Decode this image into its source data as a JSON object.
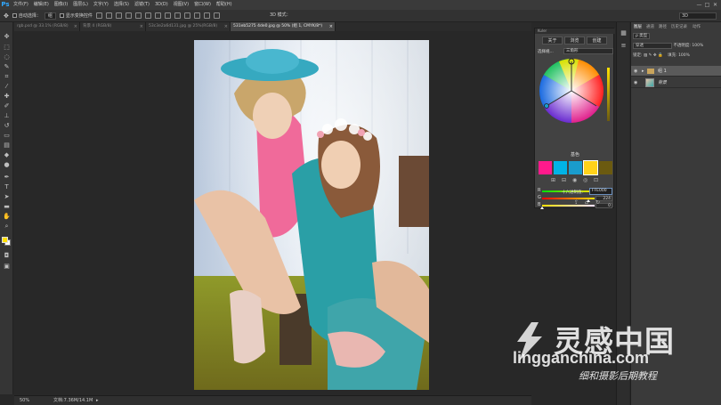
{
  "app": {
    "logo": "Ps",
    "menu": [
      "文件(F)",
      "编辑(E)",
      "图像(I)",
      "图层(L)",
      "文字(Y)",
      "选择(S)",
      "滤镜(T)",
      "3D(D)",
      "视图(V)",
      "窗口(W)",
      "帮助(H)"
    ],
    "window_controls": [
      "—",
      "□",
      "✕"
    ]
  },
  "options_bar": {
    "auto_select_label": "自动选择：",
    "auto_select_value": "组",
    "show_transform_label": "显示变换控件",
    "mode3d_label": "3D 模式：",
    "workspace": "3D"
  },
  "tabs": [
    {
      "label": "rgb.psd @ 33.1% (RGB/8)",
      "active": false
    },
    {
      "label": "背景 4 (RGB/8)",
      "active": false
    },
    {
      "label": "53c3e2a6d131.jpg @ 25%(RGB/8)",
      "active": false
    },
    {
      "label": "531eb5275 4de0.jpg @ 50% (组 1, CMYK/8*)",
      "active": true
    }
  ],
  "status": {
    "zoom": "50%",
    "doc_size": "文档:7.36M/14.1M"
  },
  "color_panel": {
    "title": "Kuler",
    "tabs": [
      "关于",
      "浏览",
      "创建"
    ],
    "scheme_label": "选择规...",
    "scheme_value": "三角形",
    "base_color_label": "基色",
    "swatches": [
      "#ff1a8c",
      "#00b3e6",
      "#1a9ccc",
      "#ffd21a",
      "#6b5a10"
    ],
    "sliders": [
      {
        "label": "R",
        "value": "255",
        "fraction": 1.0,
        "gradient": [
          "#00e000",
          "#ffe000"
        ]
      },
      {
        "label": "G",
        "value": "224",
        "fraction": 0.88,
        "gradient": [
          "#ff0000",
          "#ffe000"
        ]
      },
      {
        "label": "B",
        "value": "0",
        "fraction": 0.0,
        "gradient": [
          "#ffe000",
          "#ffe0ff"
        ]
      }
    ],
    "hex_label": "十六进制值:",
    "hex_value": "FFE000"
  },
  "layers_panel": {
    "tabs": [
      "图层",
      "通道",
      "路径",
      "历史记录",
      "动作"
    ],
    "filter_label": "ρ 类型",
    "blend_mode": "穿透",
    "opacity_label": "不透明度:",
    "opacity_value": "100%",
    "lock_label": "锁定:",
    "fill_label": "填充:",
    "fill_value": "100%",
    "layers": [
      {
        "name": "组 1",
        "type": "group"
      },
      {
        "name": "背景",
        "type": "image"
      }
    ]
  },
  "watermark": {
    "brand": "灵感中国",
    "url": "lingganchina.com",
    "tagline": "细和摄影后期教程"
  },
  "colors": {
    "foreground": "#ffe000",
    "background": "#ffffff",
    "accent": "#31a8ff"
  }
}
